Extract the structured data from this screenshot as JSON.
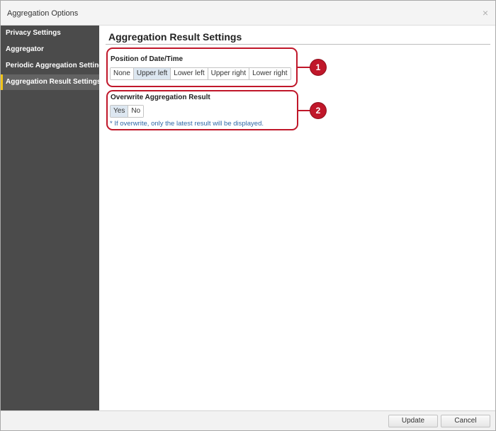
{
  "window": {
    "title": "Aggregation Options",
    "close_glyph": "×"
  },
  "sidebar": {
    "items": [
      {
        "label": "Privacy Settings",
        "active": false
      },
      {
        "label": "Aggregator",
        "active": false
      },
      {
        "label": "Periodic Aggregation Settings",
        "active": false
      },
      {
        "label": "Aggregation Result Settings",
        "active": true
      }
    ]
  },
  "main": {
    "title": "Aggregation Result Settings",
    "position_group": {
      "label": "Position of Date/Time",
      "callout_number": "1",
      "options": [
        "None",
        "Upper left",
        "Lower left",
        "Upper right",
        "Lower right"
      ],
      "selected": "Upper left"
    },
    "overwrite_group": {
      "label": "Overwrite Aggregation Result",
      "callout_number": "2",
      "options": [
        "Yes",
        "No"
      ],
      "selected": "Yes",
      "note": "* If overwrite, only the latest result will be displayed."
    }
  },
  "footer": {
    "update_label": "Update",
    "cancel_label": "Cancel"
  },
  "colors": {
    "sidebar_bg": "#4b4b4b",
    "active_accent": "#f0c419",
    "callout_red": "#c0172a",
    "note_blue": "#2f67a5",
    "selected_bg": "#dde7f1"
  },
  "icons": {
    "close": "close-icon"
  }
}
